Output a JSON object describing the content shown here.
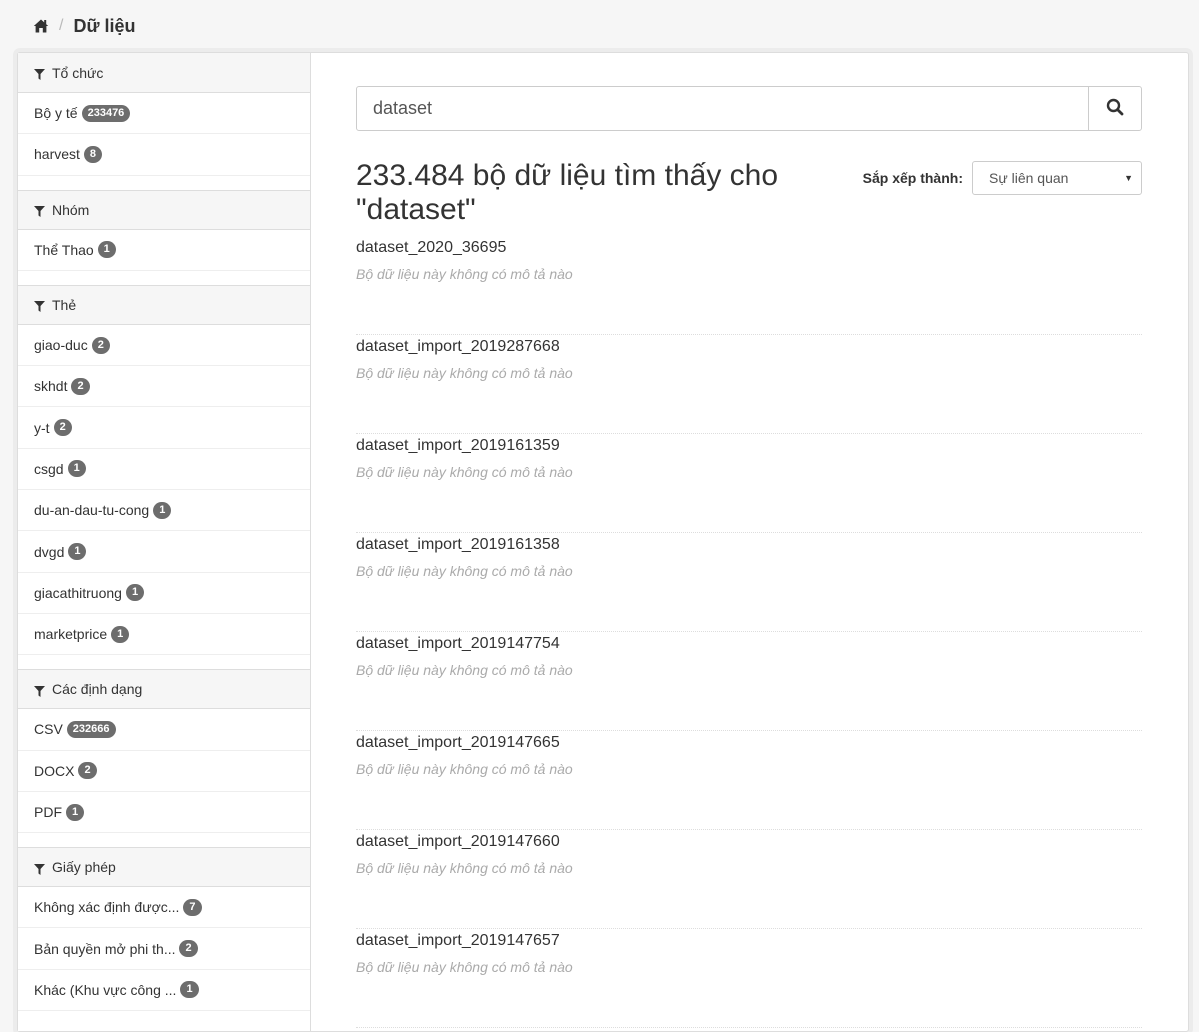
{
  "breadcrumb": {
    "current": "Dữ liệu"
  },
  "facets": [
    {
      "title": "Tổ chức",
      "items": [
        {
          "label": "Bộ y tế",
          "count": "233476"
        },
        {
          "label": "harvest",
          "count": "8"
        }
      ]
    },
    {
      "title": "Nhóm",
      "items": [
        {
          "label": "Thể Thao",
          "count": "1"
        }
      ]
    },
    {
      "title": "Thẻ",
      "items": [
        {
          "label": "giao-duc",
          "count": "2"
        },
        {
          "label": "skhdt",
          "count": "2"
        },
        {
          "label": "y-t",
          "count": "2"
        },
        {
          "label": "csgd",
          "count": "1"
        },
        {
          "label": "du-an-dau-tu-cong",
          "count": "1"
        },
        {
          "label": "dvgd",
          "count": "1"
        },
        {
          "label": "giacathitruong",
          "count": "1"
        },
        {
          "label": "marketprice",
          "count": "1"
        }
      ]
    },
    {
      "title": "Các định dạng",
      "items": [
        {
          "label": "CSV",
          "count": "232666"
        },
        {
          "label": "DOCX",
          "count": "2"
        },
        {
          "label": "PDF",
          "count": "1"
        }
      ]
    },
    {
      "title": "Giấy phép",
      "items": [
        {
          "label": "Không xác định được...",
          "count": "7"
        },
        {
          "label": "Bản quyền mở phi th...",
          "count": "2"
        },
        {
          "label": "Khác (Khu vực công ...",
          "count": "1"
        }
      ]
    }
  ],
  "search": {
    "value": "dataset"
  },
  "results_heading": "233.484 bộ dữ liệu tìm thấy cho \"dataset\"",
  "sort": {
    "label": "Sắp xếp thành:",
    "selected": "Sự liên quan"
  },
  "results": [
    {
      "title": "dataset_2020_36695",
      "desc": "Bộ dữ liệu này không có mô tả nào"
    },
    {
      "title": "dataset_import_2019287668",
      "desc": "Bộ dữ liệu này không có mô tả nào"
    },
    {
      "title": "dataset_import_2019161359",
      "desc": "Bộ dữ liệu này không có mô tả nào"
    },
    {
      "title": "dataset_import_2019161358",
      "desc": "Bộ dữ liệu này không có mô tả nào"
    },
    {
      "title": "dataset_import_2019147754",
      "desc": "Bộ dữ liệu này không có mô tả nào"
    },
    {
      "title": "dataset_import_2019147665",
      "desc": "Bộ dữ liệu này không có mô tả nào"
    },
    {
      "title": "dataset_import_2019147660",
      "desc": "Bộ dữ liệu này không có mô tả nào"
    },
    {
      "title": "dataset_import_2019147657",
      "desc": "Bộ dữ liệu này không có mô tả nào"
    }
  ]
}
